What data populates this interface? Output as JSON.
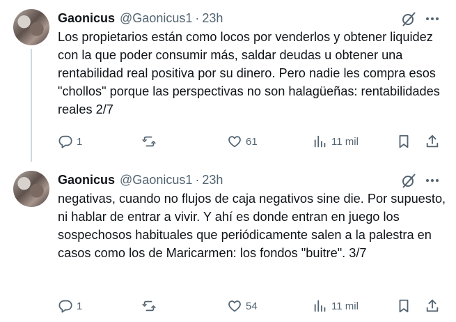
{
  "tweets": [
    {
      "author_name": "Gaonicus",
      "handle": "@Gaonicus1",
      "separator": "·",
      "time": "23h",
      "text": "Los propietarios están como locos por venderlos y obtener liquidez con la que poder consumir más, saldar deudas u obtener una rentabilidad real positiva por su dinero. Pero nadie les compra esos \"chollos\" porque las perspectivas no son halagüeñas: rentabilidades reales 2/7",
      "replies": "1",
      "retweets": "",
      "likes": "61",
      "views": "11 mil"
    },
    {
      "author_name": "Gaonicus",
      "handle": "@Gaonicus1",
      "separator": "·",
      "time": "23h",
      "text": "negativas, cuando no flujos de caja negativos sine die. Por supuesto, ni hablar de entrar a vivir. Y ahí es donde entran en juego los sospechosos habituales que periódicamente salen a la palestra en casos como los de Maricarmen: los fondos \"buitre\". 3/7",
      "replies": "1",
      "retweets": "",
      "likes": "54",
      "views": "11 mil"
    }
  ],
  "icons": {
    "reply": "reply-icon",
    "retweet": "retweet-icon",
    "like": "heart-icon",
    "views": "views-icon",
    "bookmark": "bookmark-icon",
    "share": "share-icon",
    "grok": "grok-icon",
    "more": "more-icon"
  },
  "colors": {
    "text": "#0f1419",
    "secondary": "#536471",
    "thread_line": "#cfd9de"
  }
}
